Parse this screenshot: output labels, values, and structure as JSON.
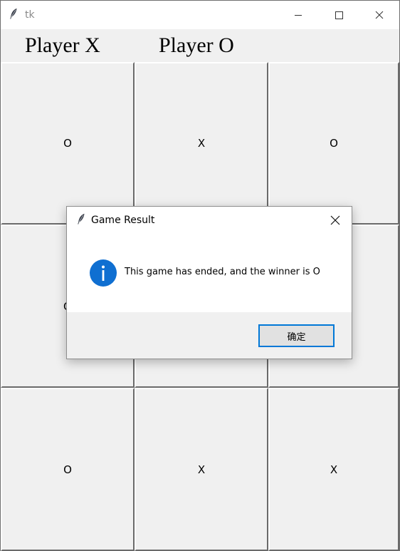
{
  "window": {
    "title": "tk",
    "icon": "feather-icon"
  },
  "window_controls": {
    "minimize_icon": "minimize-icon",
    "maximize_icon": "maximize-icon",
    "close_icon": "close-icon"
  },
  "players": {
    "x_label": "Player X",
    "o_label": "Player O"
  },
  "board": {
    "cells": [
      "O",
      "X",
      "O",
      "O",
      "",
      "",
      "O",
      "X",
      "X"
    ]
  },
  "dialog": {
    "title": "Game Result",
    "icon": "feather-icon",
    "message_icon": "info-icon",
    "message": "This game has ended, and the winner is O",
    "ok_label": "确定",
    "close_icon": "close-icon"
  },
  "colors": {
    "info_icon_blue": "#0f6fd1",
    "button_focus_border": "#0078d7"
  }
}
